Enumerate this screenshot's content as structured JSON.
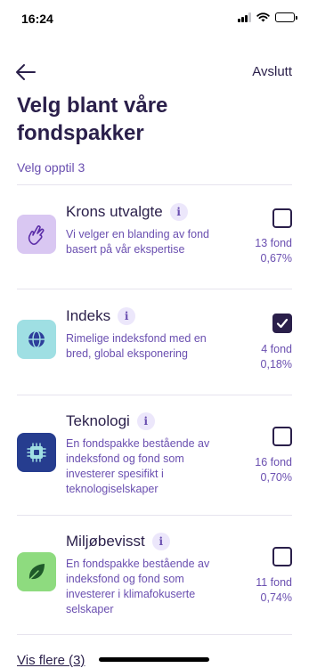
{
  "status_bar": {
    "time": "16:24",
    "signal_icon": "signal-icon",
    "wifi_icon": "wifi-icon",
    "battery_icon": "battery-icon"
  },
  "nav": {
    "back_icon": "arrow-left-icon",
    "exit_label": "Avslutt"
  },
  "page": {
    "title": "Velg blant våre fondspakker",
    "subtitle": "Velg opptil 3",
    "show_more_label": "Vis flere (3)"
  },
  "colors": {
    "primary": "#2a1f4a",
    "accent": "#6a4fb0",
    "divider": "#e6e3ee"
  },
  "packages": [
    {
      "name": "Krons utvalgte",
      "info": "i",
      "description": "Vi velger en blanding av fond basert på vår ekspertise",
      "fund_count": "13 fond",
      "fee": "0,67%",
      "selected": false,
      "icon": "hand-gesture-icon",
      "icon_bg": "#d9c7f2"
    },
    {
      "name": "Indeks",
      "info": "i",
      "description": "Rimelige indeksfond med en bred, global eksponering",
      "fund_count": "4 fond",
      "fee": "0,18%",
      "selected": true,
      "icon": "globe-icon",
      "icon_bg": "#9fdfe3"
    },
    {
      "name": "Teknologi",
      "info": "i",
      "description": "En fondspakke bestående av indeksfond og fond som investerer spesifikt i teknologiselskaper",
      "fund_count": "16 fond",
      "fee": "0,70%",
      "selected": false,
      "icon": "chip-icon",
      "icon_bg": "#263d8f"
    },
    {
      "name": "Miljøbevisst",
      "info": "i",
      "description": "En fondspakke bestående av indeksfond og fond som investerer i klimafokuserte selskaper",
      "fund_count": "11 fond",
      "fee": "0,74%",
      "selected": false,
      "icon": "leaf-icon",
      "icon_bg": "#8edb7f"
    }
  ]
}
